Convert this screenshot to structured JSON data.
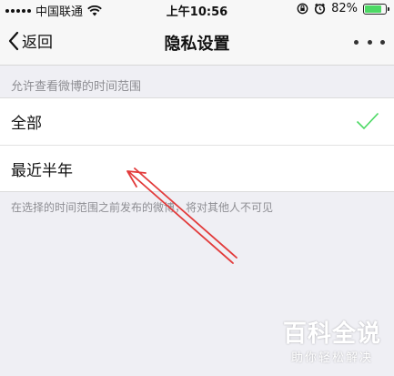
{
  "status_bar": {
    "carrier": "中国联通",
    "time": "上午10:56",
    "battery_percent": "82%",
    "battery_level": 0.82,
    "battery_color": "#4cd964"
  },
  "nav": {
    "back_label": "返回",
    "title": "隐私设置"
  },
  "section": {
    "header": "允许查看微博的时间范围",
    "options": [
      {
        "label": "全部",
        "selected": true
      },
      {
        "label": "最近半年",
        "selected": false
      }
    ],
    "footnote": "在选择的时间范围之前发布的微博，将对其他人不可见"
  },
  "colors": {
    "checkmark": "#4cd964",
    "arrow": "#e23b3b"
  },
  "watermark": {
    "main": "百科全说",
    "sub": "助你轻松解决"
  }
}
